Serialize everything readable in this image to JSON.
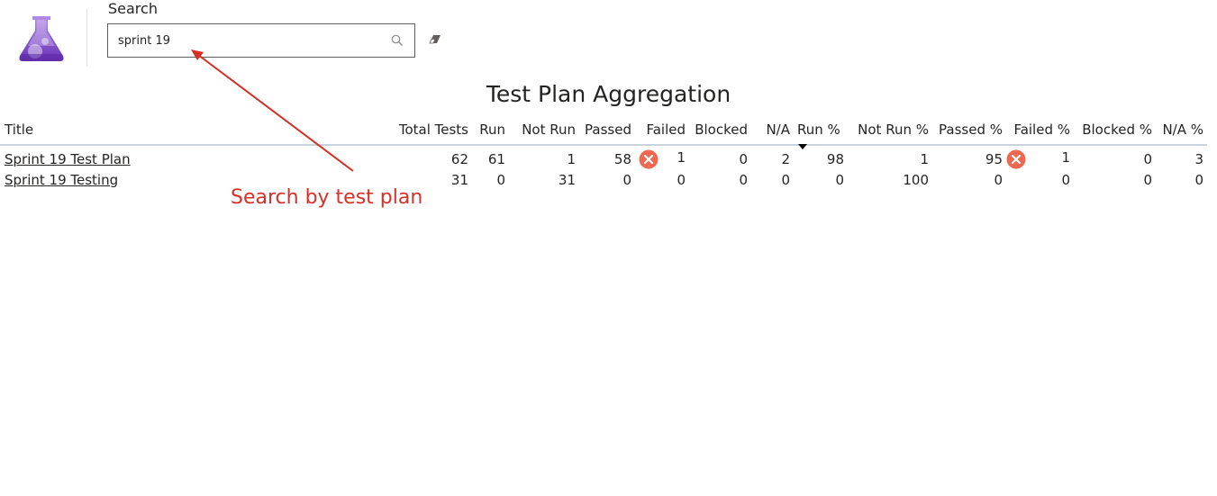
{
  "colors": {
    "annotation": "#d92f25",
    "failed_icon": "#ef6950",
    "logo_purple": "#7b3fc9"
  },
  "logo": {
    "icon": "flask-icon"
  },
  "search": {
    "title": "Search",
    "value": "sprint 19",
    "search_icon": "search-icon",
    "clear_icon": "eraser-icon"
  },
  "table": {
    "title": "Test Plan Aggregation",
    "columns": [
      "Title",
      "Total Tests",
      "Run",
      "Not Run",
      "Passed",
      "Failed",
      "Blocked",
      "N/A",
      "Run %",
      "Not Run %",
      "Passed %",
      "Failed %",
      "Blocked %",
      "N/A %"
    ],
    "sorted_column": "Run %",
    "sort_direction": "descending",
    "rows": [
      {
        "title": "Sprint 19 Test Plan",
        "total": "62",
        "run": "61",
        "not_run": "1",
        "passed": "58",
        "failed": "1",
        "failed_flag": true,
        "blocked": "0",
        "na": "2",
        "run_pct": "98",
        "not_run_pct": "1",
        "passed_pct": "95",
        "failed_pct": "1",
        "failed_pct_flag": true,
        "blocked_pct": "0",
        "na_pct": "3"
      },
      {
        "title": "Sprint 19 Testing",
        "total": "31",
        "run": "0",
        "not_run": "31",
        "passed": "0",
        "failed": "0",
        "failed_flag": false,
        "blocked": "0",
        "na": "0",
        "run_pct": "0",
        "not_run_pct": "100",
        "passed_pct": "0",
        "failed_pct": "0",
        "failed_pct_flag": false,
        "blocked_pct": "0",
        "na_pct": "0"
      }
    ]
  },
  "annotation": {
    "text": "Search by test plan"
  }
}
